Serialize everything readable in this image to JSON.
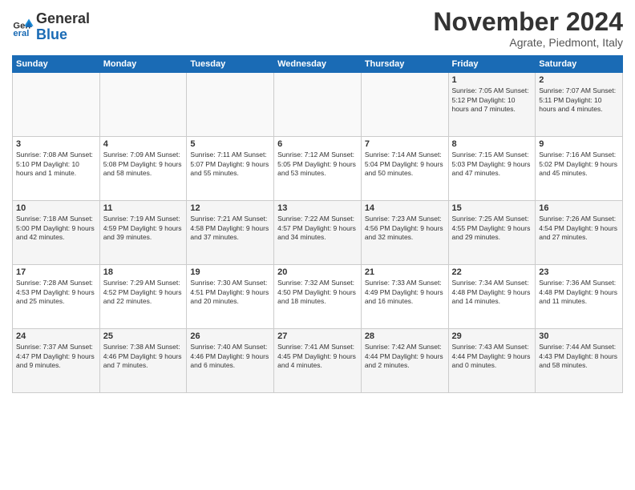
{
  "logo": {
    "line1": "General",
    "line2": "Blue"
  },
  "title": "November 2024",
  "subtitle": "Agrate, Piedmont, Italy",
  "weekdays": [
    "Sunday",
    "Monday",
    "Tuesday",
    "Wednesday",
    "Thursday",
    "Friday",
    "Saturday"
  ],
  "weeks": [
    [
      {
        "day": "",
        "info": ""
      },
      {
        "day": "",
        "info": ""
      },
      {
        "day": "",
        "info": ""
      },
      {
        "day": "",
        "info": ""
      },
      {
        "day": "",
        "info": ""
      },
      {
        "day": "1",
        "info": "Sunrise: 7:05 AM\nSunset: 5:12 PM\nDaylight: 10 hours\nand 7 minutes."
      },
      {
        "day": "2",
        "info": "Sunrise: 7:07 AM\nSunset: 5:11 PM\nDaylight: 10 hours\nand 4 minutes."
      }
    ],
    [
      {
        "day": "3",
        "info": "Sunrise: 7:08 AM\nSunset: 5:10 PM\nDaylight: 10 hours\nand 1 minute."
      },
      {
        "day": "4",
        "info": "Sunrise: 7:09 AM\nSunset: 5:08 PM\nDaylight: 9 hours\nand 58 minutes."
      },
      {
        "day": "5",
        "info": "Sunrise: 7:11 AM\nSunset: 5:07 PM\nDaylight: 9 hours\nand 55 minutes."
      },
      {
        "day": "6",
        "info": "Sunrise: 7:12 AM\nSunset: 5:05 PM\nDaylight: 9 hours\nand 53 minutes."
      },
      {
        "day": "7",
        "info": "Sunrise: 7:14 AM\nSunset: 5:04 PM\nDaylight: 9 hours\nand 50 minutes."
      },
      {
        "day": "8",
        "info": "Sunrise: 7:15 AM\nSunset: 5:03 PM\nDaylight: 9 hours\nand 47 minutes."
      },
      {
        "day": "9",
        "info": "Sunrise: 7:16 AM\nSunset: 5:02 PM\nDaylight: 9 hours\nand 45 minutes."
      }
    ],
    [
      {
        "day": "10",
        "info": "Sunrise: 7:18 AM\nSunset: 5:00 PM\nDaylight: 9 hours\nand 42 minutes."
      },
      {
        "day": "11",
        "info": "Sunrise: 7:19 AM\nSunset: 4:59 PM\nDaylight: 9 hours\nand 39 minutes."
      },
      {
        "day": "12",
        "info": "Sunrise: 7:21 AM\nSunset: 4:58 PM\nDaylight: 9 hours\nand 37 minutes."
      },
      {
        "day": "13",
        "info": "Sunrise: 7:22 AM\nSunset: 4:57 PM\nDaylight: 9 hours\nand 34 minutes."
      },
      {
        "day": "14",
        "info": "Sunrise: 7:23 AM\nSunset: 4:56 PM\nDaylight: 9 hours\nand 32 minutes."
      },
      {
        "day": "15",
        "info": "Sunrise: 7:25 AM\nSunset: 4:55 PM\nDaylight: 9 hours\nand 29 minutes."
      },
      {
        "day": "16",
        "info": "Sunrise: 7:26 AM\nSunset: 4:54 PM\nDaylight: 9 hours\nand 27 minutes."
      }
    ],
    [
      {
        "day": "17",
        "info": "Sunrise: 7:28 AM\nSunset: 4:53 PM\nDaylight: 9 hours\nand 25 minutes."
      },
      {
        "day": "18",
        "info": "Sunrise: 7:29 AM\nSunset: 4:52 PM\nDaylight: 9 hours\nand 22 minutes."
      },
      {
        "day": "19",
        "info": "Sunrise: 7:30 AM\nSunset: 4:51 PM\nDaylight: 9 hours\nand 20 minutes."
      },
      {
        "day": "20",
        "info": "Sunrise: 7:32 AM\nSunset: 4:50 PM\nDaylight: 9 hours\nand 18 minutes."
      },
      {
        "day": "21",
        "info": "Sunrise: 7:33 AM\nSunset: 4:49 PM\nDaylight: 9 hours\nand 16 minutes."
      },
      {
        "day": "22",
        "info": "Sunrise: 7:34 AM\nSunset: 4:48 PM\nDaylight: 9 hours\nand 14 minutes."
      },
      {
        "day": "23",
        "info": "Sunrise: 7:36 AM\nSunset: 4:48 PM\nDaylight: 9 hours\nand 11 minutes."
      }
    ],
    [
      {
        "day": "24",
        "info": "Sunrise: 7:37 AM\nSunset: 4:47 PM\nDaylight: 9 hours\nand 9 minutes."
      },
      {
        "day": "25",
        "info": "Sunrise: 7:38 AM\nSunset: 4:46 PM\nDaylight: 9 hours\nand 7 minutes."
      },
      {
        "day": "26",
        "info": "Sunrise: 7:40 AM\nSunset: 4:46 PM\nDaylight: 9 hours\nand 6 minutes."
      },
      {
        "day": "27",
        "info": "Sunrise: 7:41 AM\nSunset: 4:45 PM\nDaylight: 9 hours\nand 4 minutes."
      },
      {
        "day": "28",
        "info": "Sunrise: 7:42 AM\nSunset: 4:44 PM\nDaylight: 9 hours\nand 2 minutes."
      },
      {
        "day": "29",
        "info": "Sunrise: 7:43 AM\nSunset: 4:44 PM\nDaylight: 9 hours\nand 0 minutes."
      },
      {
        "day": "30",
        "info": "Sunrise: 7:44 AM\nSunset: 4:43 PM\nDaylight: 8 hours\nand 58 minutes."
      }
    ]
  ]
}
